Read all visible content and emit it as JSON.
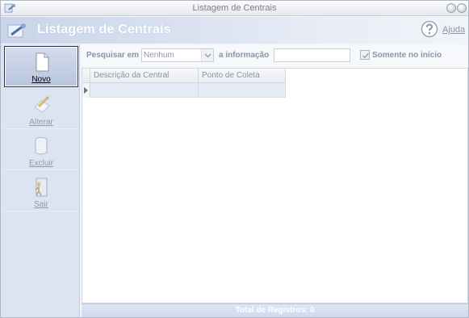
{
  "window": {
    "title": "Listagem de Centrais"
  },
  "header": {
    "title": "Listagem de Centrais",
    "help_label": "Ajuda"
  },
  "toolbar": {
    "items": [
      {
        "label": "Novo",
        "icon": "new-document-icon",
        "state": "active"
      },
      {
        "label": "Alterar",
        "icon": "edit-icon",
        "state": "disabled"
      },
      {
        "label": "Excluir",
        "icon": "trash-icon",
        "state": "disabled"
      },
      {
        "label": "Sair",
        "icon": "exit-door-icon",
        "state": "disabled"
      }
    ]
  },
  "search": {
    "search_in_label": "Pesquisar em",
    "field_value": "Nenhum",
    "info_label": "a informação",
    "info_value": "",
    "starts_with_label": "Somente no início",
    "starts_with_checked": true
  },
  "grid": {
    "columns": [
      "Descrição da Central",
      "Ponto de Coleta"
    ],
    "rows": [
      [
        "",
        ""
      ]
    ]
  },
  "footer": {
    "total_label": "Total de Registros: 0"
  }
}
